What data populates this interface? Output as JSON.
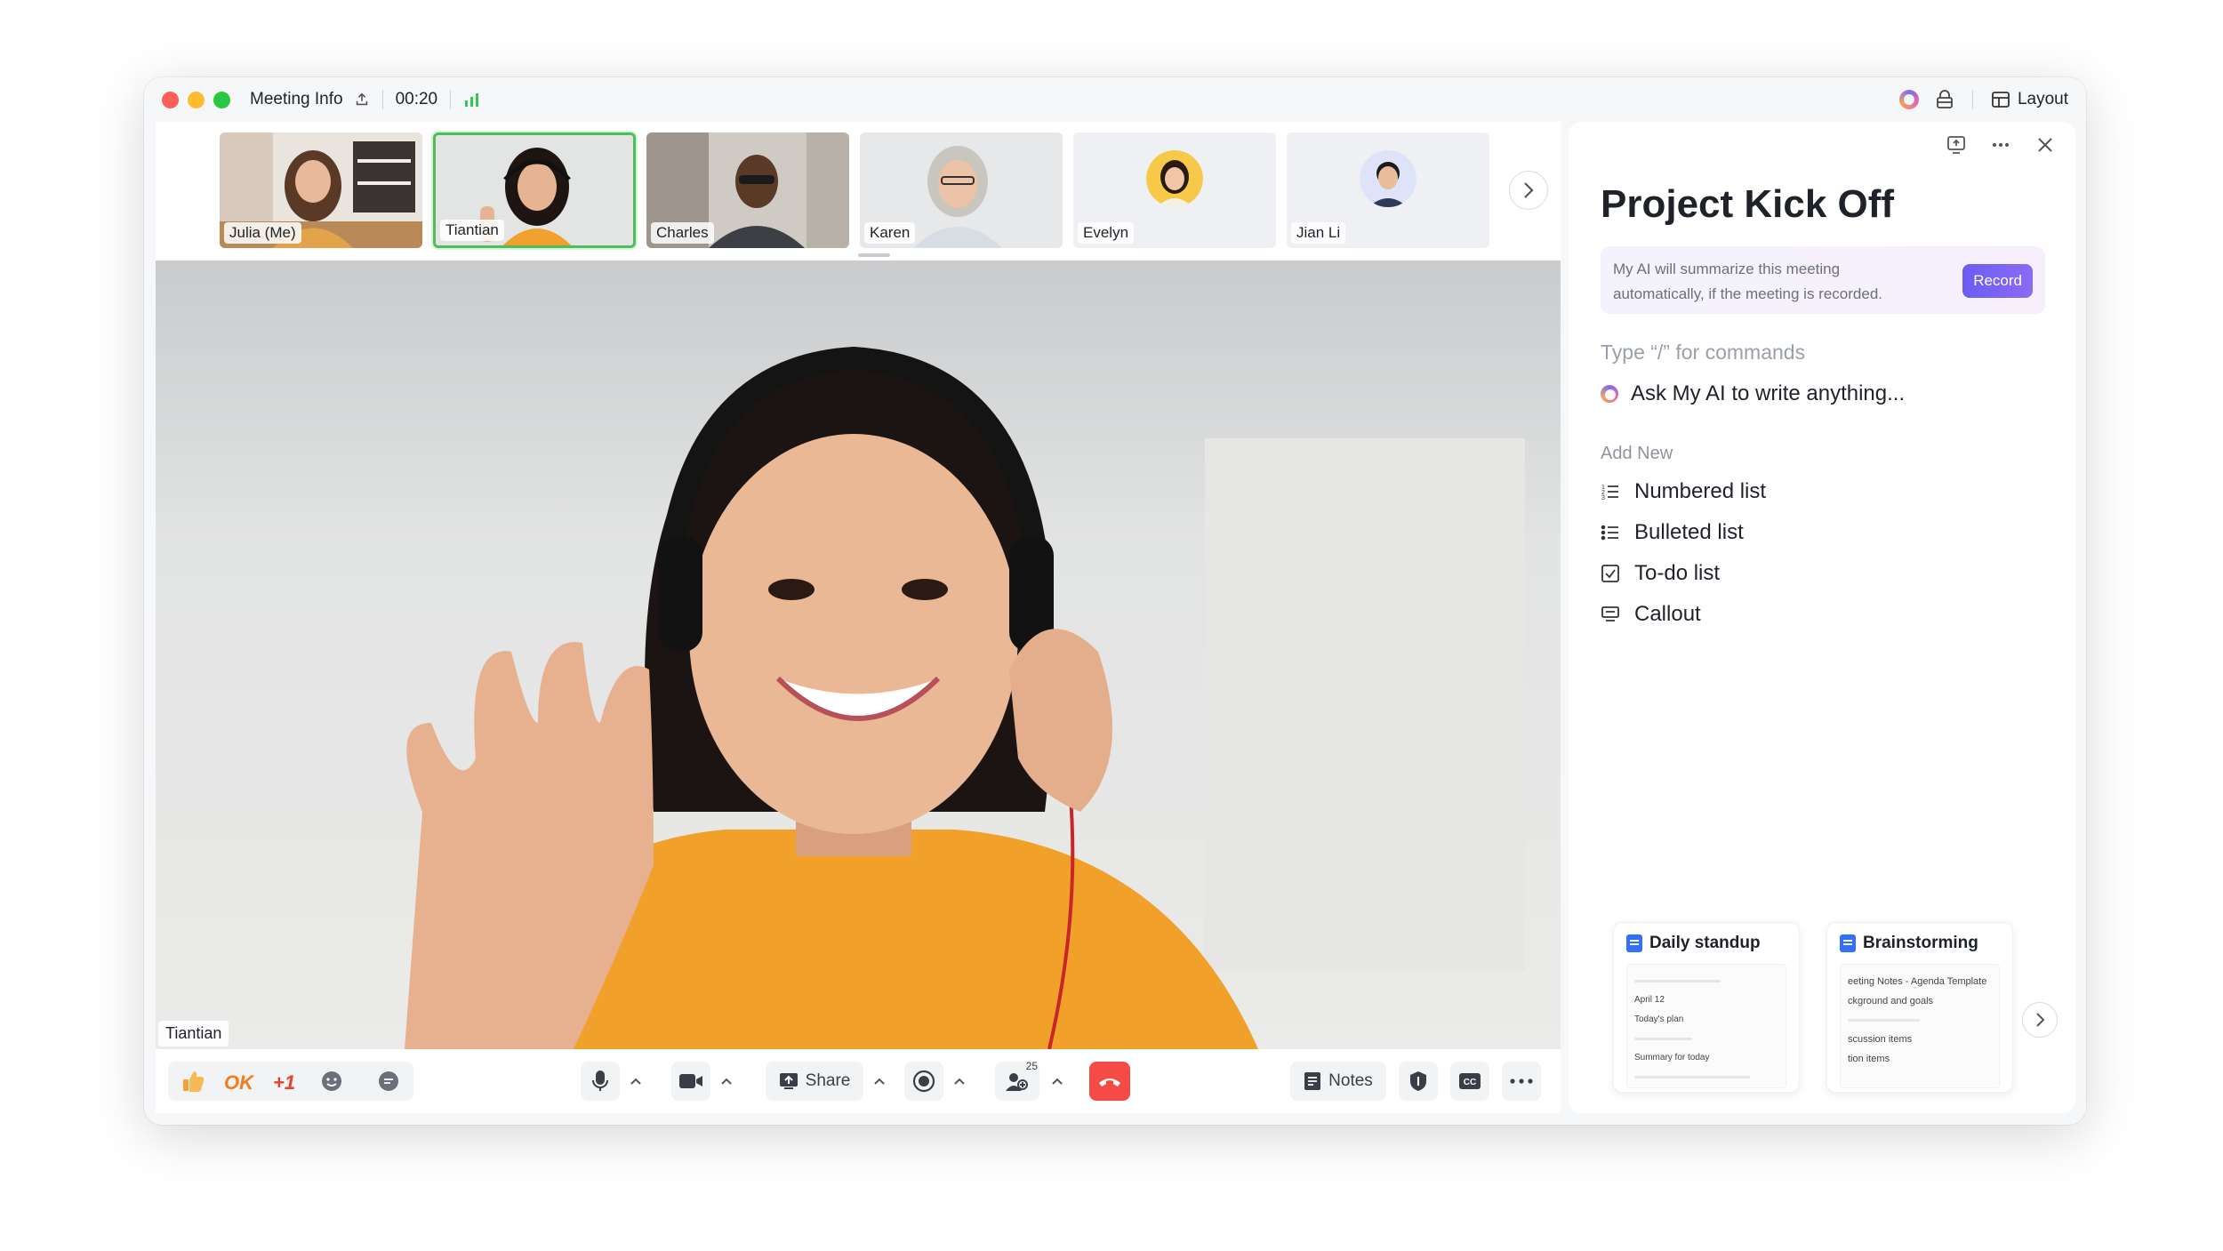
{
  "titlebar": {
    "meeting_info": "Meeting Info",
    "timer": "00:20",
    "layout_label": "Layout"
  },
  "participants": [
    {
      "name": "Julia (Me)"
    },
    {
      "name": "Tiantian",
      "active": true
    },
    {
      "name": "Charles"
    },
    {
      "name": "Karen"
    },
    {
      "name": "Evelyn"
    },
    {
      "name": "Jian Li"
    }
  ],
  "main_video": {
    "speaker": "Tiantian"
  },
  "controls": {
    "reaction_ok": "OK",
    "reaction_plus1": "+1",
    "share_label": "Share",
    "participants_count": "25",
    "notes_label": "Notes"
  },
  "panel": {
    "title": "Project Kick Off",
    "ai_banner_text": "My AI will summarize this meeting automatically, if the meeting is recorded.",
    "record_label": "Record",
    "placeholder": "Type “/” for commands",
    "ask_ai": "Ask My AI to write anything...",
    "add_new_label": "Add New",
    "menu": [
      {
        "label": "Numbered list",
        "icon": "numbered-list-icon"
      },
      {
        "label": "Bulleted list",
        "icon": "bulleted-list-icon"
      },
      {
        "label": "To-do list",
        "icon": "todo-list-icon"
      },
      {
        "label": "Callout",
        "icon": "callout-icon"
      }
    ],
    "templates": [
      {
        "title": "Daily standup",
        "preview_lines": [
          "April 12",
          "Today's plan",
          "Summary for today"
        ]
      },
      {
        "title": "Brainstorming",
        "preview_lines": [
          "eeting Notes - Agenda Template",
          "ckground and goals",
          "scussion items",
          "tion items"
        ]
      }
    ]
  },
  "colors": {
    "accent_green": "#4ebd5a",
    "hangup_red": "#f54a45",
    "record_purple": "#6b5cf4",
    "doc_blue": "#3370ff"
  }
}
